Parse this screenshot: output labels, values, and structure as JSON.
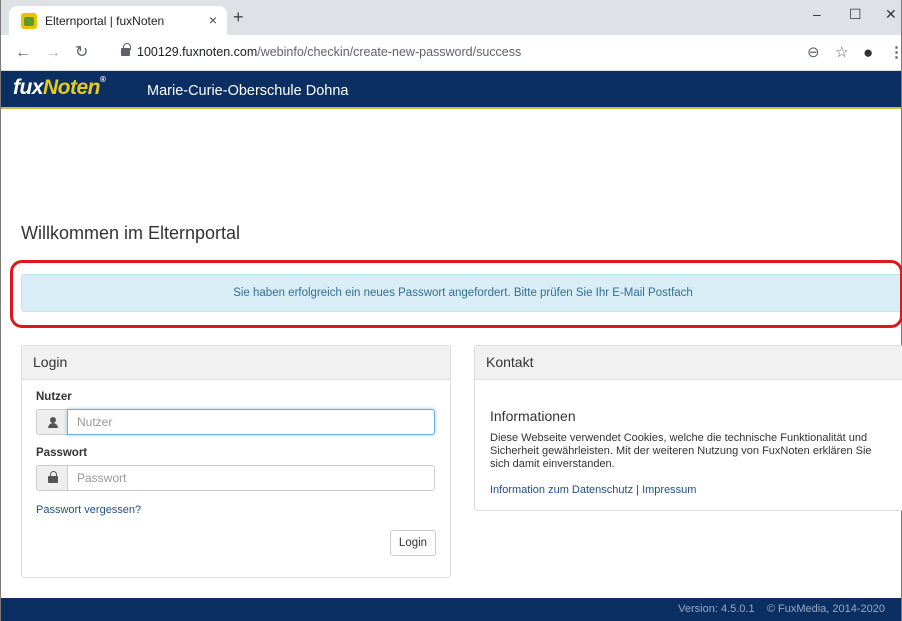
{
  "browser": {
    "tab_title": "Elternportal | fuxNoten",
    "tab_close": "×",
    "new_tab": "+",
    "url_host": "100129.fuxnoten.com",
    "url_path": "/webinfo/checkin/create-new-password/success",
    "win_minimize": "–",
    "win_maximize": "☐",
    "win_close": "✕"
  },
  "header": {
    "brand_fux": "fux",
    "brand_noten": "Noten",
    "brand_reg": "®",
    "school": "Marie-Curie-Oberschule Dohna"
  },
  "page": {
    "welcome": "Willkommen im Elternportal",
    "alert": "Sie haben erfolgreich ein neues Passwort angefordert. Bitte prüfen Sie Ihr E-Mail Postfach"
  },
  "login": {
    "heading": "Login",
    "user_label": "Nutzer",
    "user_placeholder": "Nutzer",
    "password_label": "Passwort",
    "password_placeholder": "Passwort",
    "forgot": "Passwort vergessen?",
    "submit": "Login"
  },
  "contact": {
    "heading": "Kontakt",
    "info_title": "Informationen",
    "info_text": "Diese Webseite verwendet Cookies, welche die technische Funktionalität und Sicherheit gewährleisten. Mit der weiteren Nutzung von FuxNoten erklären Sie sich damit einverstanden.",
    "privacy_link": "Information zum Datenschutz",
    "separator": "|",
    "imprint_link": "Impressum"
  },
  "footer": {
    "text": "Version: 4.5.0.1    © FuxMedia, 2014-2020"
  }
}
